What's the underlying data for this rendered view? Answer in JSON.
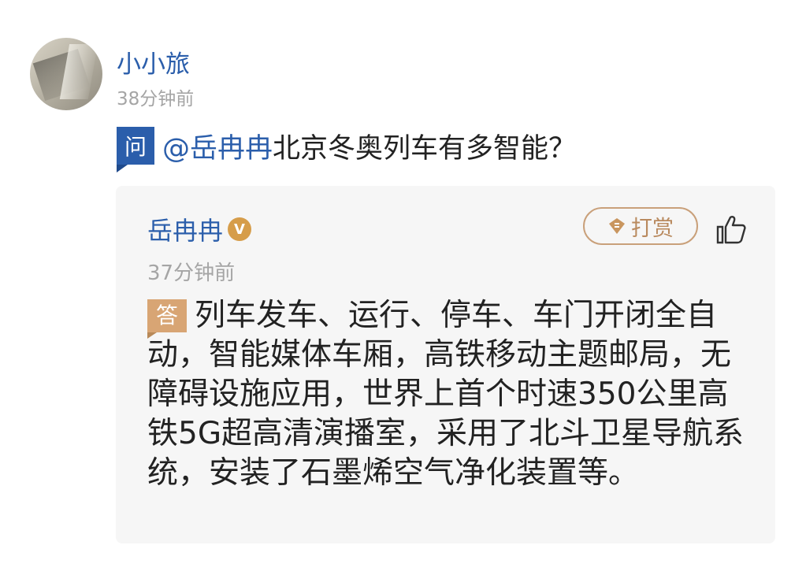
{
  "post": {
    "username": "小小旅",
    "time": "38分钟前",
    "question_badge": "问",
    "mention": "@岳冉冉",
    "question": "北京冬奥列车有多智能？"
  },
  "answer": {
    "name": "岳冉冉",
    "verified_badge": "V",
    "time": "37分钟前",
    "tip_label": "打赏",
    "answer_badge": "答",
    "text": "列车发车、运行、停车、车门开闭全自动，智能媒体车厢，高铁移动主题邮局，无障碍设施应用，世界上首个时速350公里高铁5G超高清演播室，采用了北斗卫星导航系统，安装了石墨烯空气净化装置等。"
  },
  "icons": [
    "avatar",
    "verified-icon",
    "tip-icon",
    "like-icon"
  ],
  "colors": {
    "link_blue": "#2b5eab",
    "badge_gold": "#d8a574",
    "tip_border": "#c9a07a",
    "card_bg": "#f6f6f6",
    "muted": "#a5a5a5"
  }
}
